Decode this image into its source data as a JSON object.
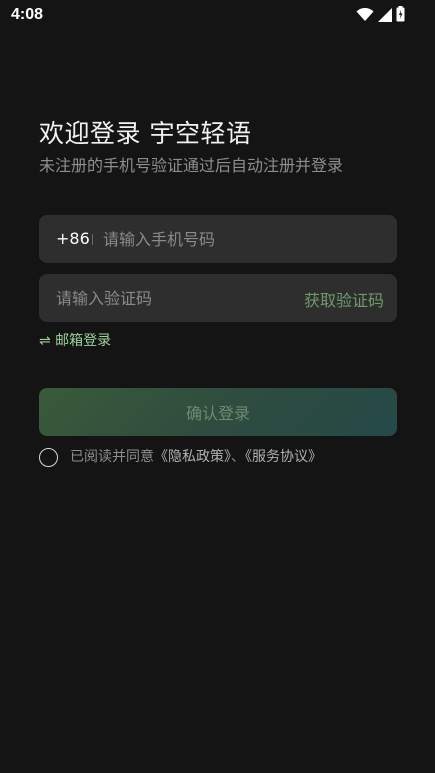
{
  "status_bar": {
    "time": "4:08",
    "icons": [
      "wifi-icon",
      "signal-icon",
      "battery-icon"
    ]
  },
  "header": {
    "title": "欢迎登录 宇空轻语",
    "subtitle": "未注册的手机号验证通过后自动注册并登录"
  },
  "phone_field": {
    "prefix": "+86",
    "placeholder": "请输入手机号码",
    "value": ""
  },
  "code_field": {
    "placeholder": "请输入验证码",
    "value": "",
    "get_code_label": "获取验证码"
  },
  "email_login": {
    "icon": "swap-icon",
    "label": "⇌ 邮箱登录"
  },
  "confirm_button": {
    "label": "确认登录"
  },
  "agreement": {
    "checked": false,
    "prefix": "已阅读并同意",
    "privacy_label": "《隐私政策》",
    "separator": "、",
    "service_label": "《服务协议》"
  },
  "colors": {
    "background": "#141414",
    "field_bg": "#2e2e2e",
    "accent_green": "#9bd39a",
    "get_code_green": "#6f9a6c"
  }
}
